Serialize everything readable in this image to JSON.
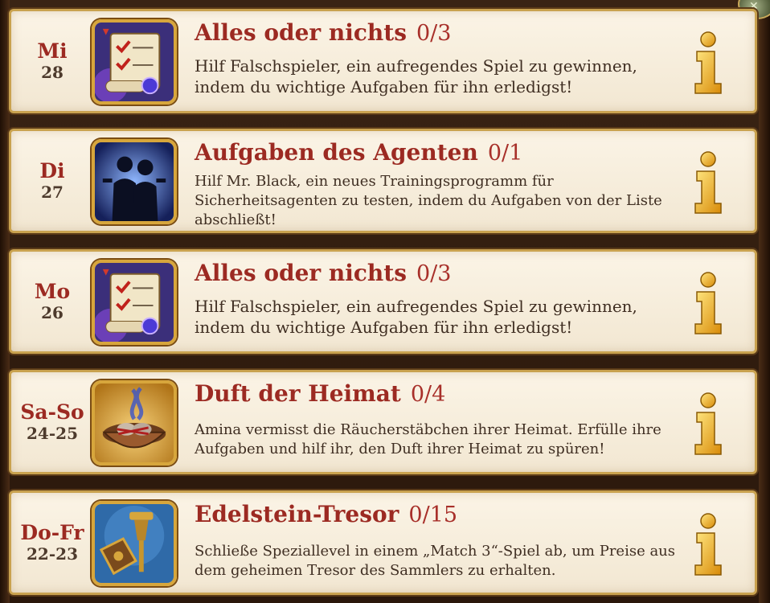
{
  "quests": [
    {
      "day": "Mi",
      "date": "28",
      "title": "Alles oder nichts",
      "progress": "0/3",
      "description": "Hilf Falschspieler, ein aufregendes Spiel zu gewinnen, indem du wichtige Aufgaben für ihn erledigst!",
      "icon": "scroll-checklist-icon"
    },
    {
      "day": "Di",
      "date": "27",
      "title": "Aufgaben des Agenten",
      "progress": "0/1",
      "description": "Hilf Mr. Black, ein neues Trainingsprogramm für Sicherheitsagenten zu testen, indem du Aufgaben von der Liste abschließt!",
      "icon": "agents-silhouette-icon"
    },
    {
      "day": "Mo",
      "date": "26",
      "title": "Alles oder nichts",
      "progress": "0/3",
      "description": "Hilf Falschspieler, ein aufregendes Spiel zu gewinnen, indem du wichtige Aufgaben für ihn erledigst!",
      "icon": "scroll-checklist-icon"
    },
    {
      "day": "Sa-So",
      "date": "24-25",
      "title": "Duft der Heimat",
      "progress": "0/4",
      "description": "Amina vermisst die Räucherstäbchen ihrer Heimat. Erfülle ihre Aufgaben und hilf ihr, den Duft ihrer Heimat zu spüren!",
      "icon": "incense-bowl-icon"
    },
    {
      "day": "Do-Fr",
      "date": "22-23",
      "title": "Edelstein-Tresor",
      "progress": "0/15",
      "description": "Schließe Speziallevel in einem „Match 3“-Spiel ab, um Preise aus dem geheimen Tresor des Sammlers zu erhalten.",
      "icon": "treasure-vault-icon"
    }
  ],
  "info_button_icon": "info-icon",
  "colors": {
    "card_bg": "#f6ecd9",
    "card_border": "#c9a24f",
    "title": "#9c2a22",
    "text": "#3f2e22",
    "background": "#3a2414"
  }
}
